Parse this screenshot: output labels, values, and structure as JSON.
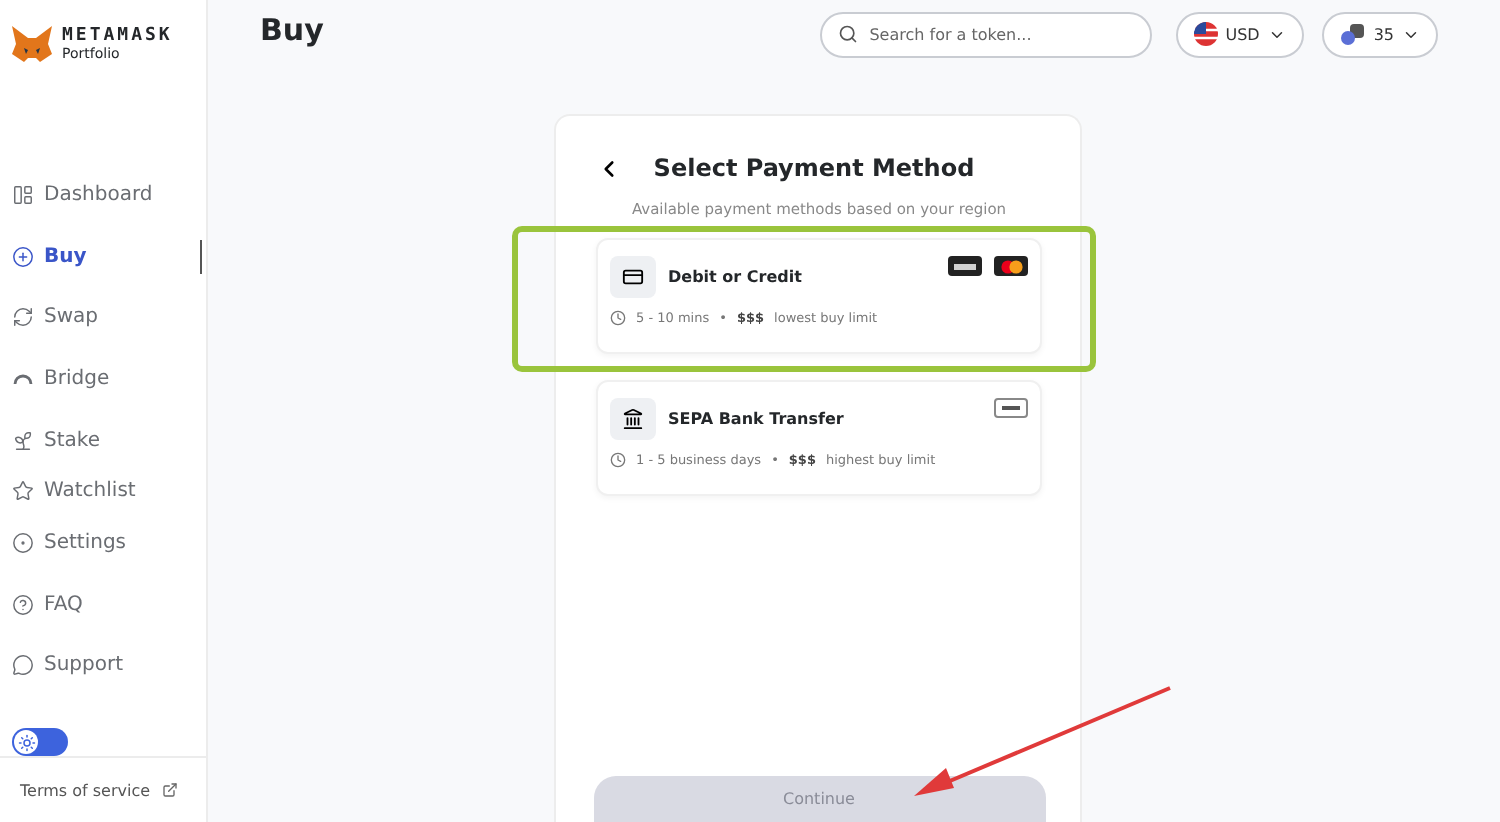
{
  "brand": {
    "name": "METAMASK",
    "sub": "Portfolio"
  },
  "sidebar": {
    "items": [
      {
        "label": "Dashboard",
        "selected": false
      },
      {
        "label": "Buy",
        "selected": true
      },
      {
        "label": "Swap",
        "selected": false
      },
      {
        "label": "Bridge",
        "selected": false
      },
      {
        "label": "Stake",
        "selected": false
      },
      {
        "label": "Watchlist",
        "selected": false
      },
      {
        "label": "Settings",
        "selected": false
      },
      {
        "label": "FAQ",
        "selected": false
      },
      {
        "label": "Support",
        "selected": false
      }
    ],
    "theme_toggle": {
      "on": false
    },
    "footer_link": "Terms of service"
  },
  "page_title": "Buy",
  "search": {
    "placeholder": "Search for a token..."
  },
  "currency": "USD",
  "network_count": "35",
  "panel": {
    "title": "Select Payment Method",
    "subtitle": "Available payment methods based on your region",
    "methods": [
      {
        "kind": "card",
        "name": "Debit or Credit",
        "time": "5 - 10 mins",
        "separator": "•",
        "cost": "$$$",
        "limit": "lowest buy limit",
        "highlighted": true
      },
      {
        "kind": "bank",
        "name": "SEPA Bank Transfer",
        "time": "1 - 5 business days",
        "separator": "•",
        "cost": "$$$",
        "limit": "highest buy limit",
        "highlighted": false
      }
    ],
    "button": {
      "label": "Continue",
      "disabled": true
    }
  }
}
